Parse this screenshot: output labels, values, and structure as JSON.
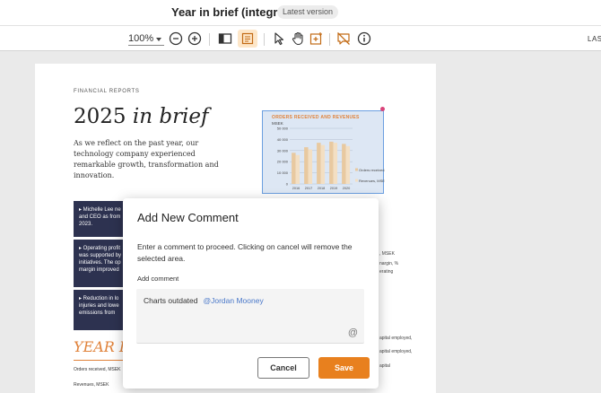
{
  "header": {
    "title": "Year in brief (integrate)",
    "version_badge": "Latest version"
  },
  "toolbar": {
    "zoom": "100%",
    "cut_label": "LAS",
    "icons": [
      "zoom-out-icon",
      "zoom-in-icon",
      "sidebar-toggle-icon",
      "comments-panel-icon",
      "pointer-icon",
      "hand-pan-icon",
      "add-comment-area-icon",
      "hide-comments-icon",
      "info-icon"
    ],
    "accent_color": "#e8801e"
  },
  "document": {
    "section_label": "FINANCIAL REPORTS",
    "title_year": "2025",
    "title_rest": "in brief",
    "intro": "As we reflect on the past year, our technology company experienced remarkable growth, transformation and innovation.",
    "bullets": [
      "▸ Michelle Lee ne and CEO as from 2023.",
      "▸ Operating profit was supported by initiatives. The op margin improved",
      "▸ Reduction in lo injuries and lowe emissions from"
    ],
    "year_heading": "YEAR IN",
    "rows": [
      "Orders received, MSEK",
      "Revenues, MSEK"
    ],
    "side_notes": [
      ", MSEK",
      "nargin, %",
      "erating",
      "apital employed,",
      "apital employed,",
      "apital"
    ]
  },
  "chart_data": {
    "type": "bar",
    "title": "ORDERS RECEIVED AND REVENUES",
    "ylabel": "MSEK",
    "categories": [
      "2016",
      "2017",
      "2018",
      "2019",
      "2020"
    ],
    "series": [
      {
        "name": "Orders received, MSEK",
        "values": [
          28000,
          33000,
          37000,
          38000,
          36000
        ]
      },
      {
        "name": "Revenues, MSEK",
        "values": [
          26000,
          31000,
          35000,
          37000,
          34000
        ]
      }
    ],
    "yticks": [
      "0",
      "10 000",
      "20 000",
      "30 000",
      "40 000",
      "50 000"
    ],
    "ylim": [
      0,
      50000
    ],
    "colors": [
      "#e8c9a0",
      "#f3dfc3"
    ]
  },
  "modal": {
    "title": "Add New Comment",
    "message": "Enter a comment to proceed. Clicking on cancel will remove the selected area.",
    "field_label": "Add comment",
    "comment_text": "Charts outdated",
    "mention": "@Jordan Mooney",
    "at_symbol": "@",
    "cancel_label": "Cancel",
    "save_label": "Save"
  }
}
